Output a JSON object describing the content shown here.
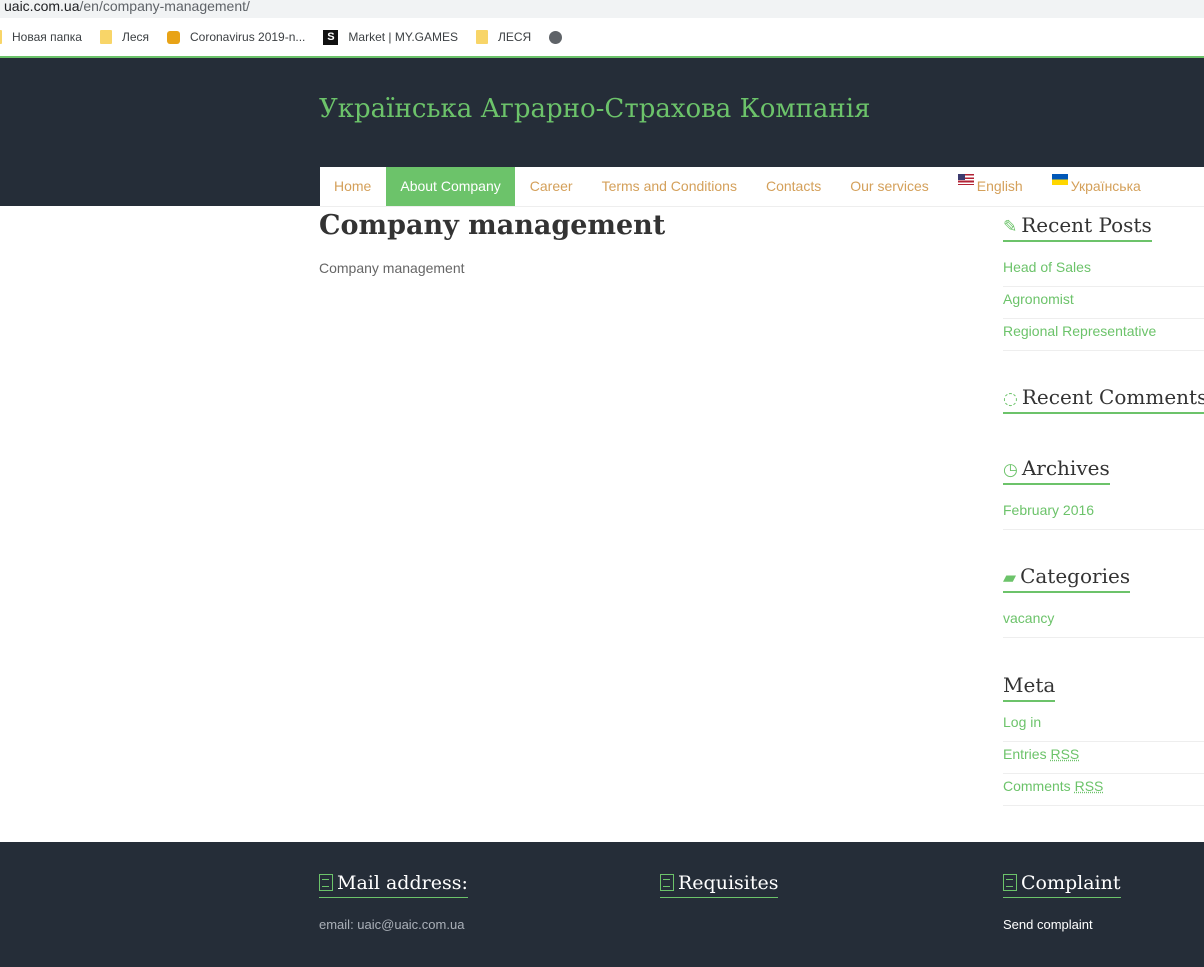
{
  "browser": {
    "url_host": "uaic.com.ua",
    "url_path": "/en/company-management/",
    "bookmarks": [
      {
        "label": "Новая папка",
        "icon": "folder-icon"
      },
      {
        "label": "Леся",
        "icon": "folder-icon"
      },
      {
        "label": "Coronavirus 2019-n...",
        "icon": "coronavirus-site-icon"
      },
      {
        "label": "Market | MY.GAMES",
        "icon": "mygames-icon"
      },
      {
        "label": "ЛЕСЯ",
        "icon": "folder-icon"
      },
      {
        "label": "",
        "icon": "globe-icon"
      }
    ]
  },
  "site": {
    "title": "Українська Аграрно-Страхова Компанія",
    "nav": [
      {
        "label": "Home",
        "active": false
      },
      {
        "label": "About Company",
        "active": true
      },
      {
        "label": "Career",
        "active": false
      },
      {
        "label": "Terms and Conditions",
        "active": false
      },
      {
        "label": "Contacts",
        "active": false
      },
      {
        "label": "Our services",
        "active": false
      },
      {
        "label": "English",
        "flag": "us-flag-icon"
      },
      {
        "label": "Українська",
        "flag": "ua-flag-icon"
      }
    ]
  },
  "main": {
    "title": "Company management",
    "body": "Company management"
  },
  "sidebar": {
    "recent_posts": {
      "title": "Recent Posts",
      "icon": "pencil-icon",
      "items": [
        "Head of Sales",
        "Agronomist",
        "Regional Representative"
      ]
    },
    "recent_comments": {
      "title": "Recent Comments",
      "icon": "comments-icon"
    },
    "archives": {
      "title": "Archives",
      "icon": "clock-icon",
      "items": [
        "February 2016"
      ]
    },
    "categories": {
      "title": "Categories",
      "icon": "folder-open-icon",
      "items": [
        "vacancy"
      ]
    },
    "meta": {
      "title": "Meta",
      "items": [
        "Log in",
        "Entries",
        "Comments"
      ],
      "rss_abbr": "RSS"
    }
  },
  "footer": {
    "mail": {
      "title": "Mail address:",
      "text": "email: uaic@uaic.com.ua"
    },
    "requisites": {
      "title": "Requisites"
    },
    "complaint": {
      "title": "Complaint",
      "link": "Send complaint"
    }
  },
  "colors": {
    "accent": "#6cc36a",
    "header_bg": "#252d38",
    "nav_link": "#d4a05a"
  }
}
